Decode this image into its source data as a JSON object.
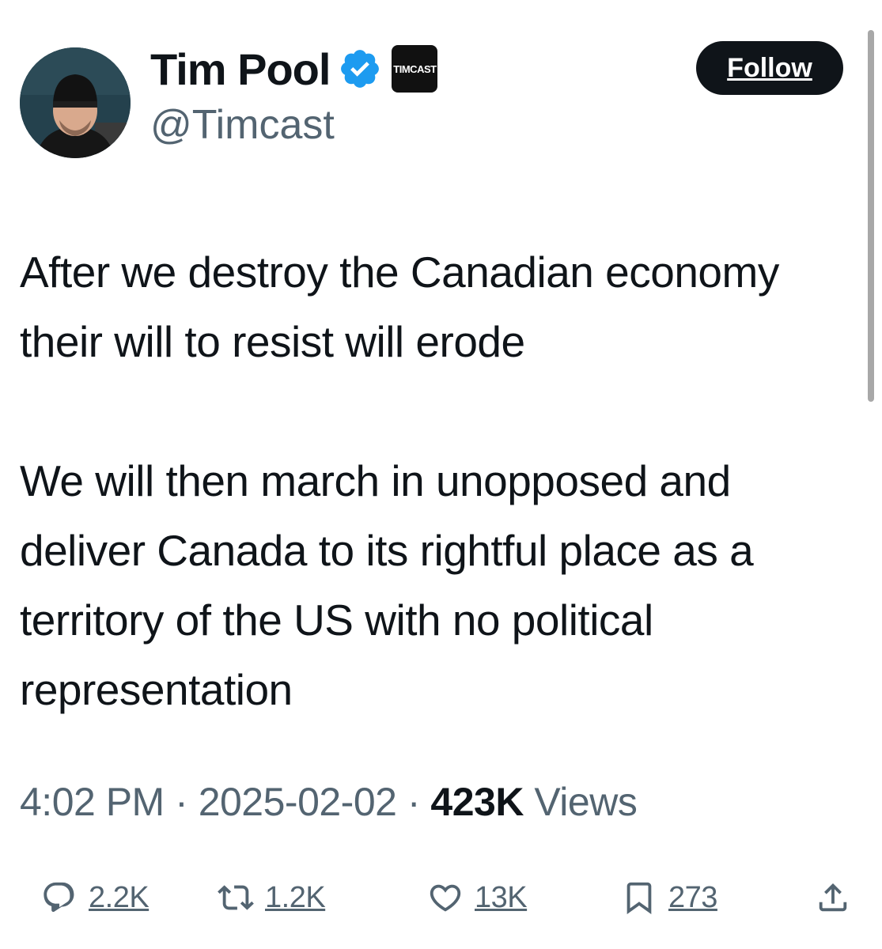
{
  "author": {
    "display_name": "Tim Pool",
    "handle": "@Timcast",
    "affiliate_badge": "TIMCAST",
    "verified": true
  },
  "follow_button": {
    "label": "Follow"
  },
  "tweet": {
    "paragraphs": [
      "After we destroy the Canadian economy their will to resist will erode",
      "We will then march in unopposed and deliver Canada to its rightful place as a territory of the US with no political representation"
    ]
  },
  "meta": {
    "time": "4:02 PM",
    "separator": "·",
    "date": "2025-02-02",
    "views_count": "423K",
    "views_label": "Views"
  },
  "actions": {
    "replies": "2.2K",
    "reposts": "1.2K",
    "likes": "13K",
    "bookmarks": "273"
  },
  "colors": {
    "text_primary": "#0f1419",
    "text_secondary": "#536471",
    "verified_blue": "#1d9bf0",
    "follow_bg": "#0f1419"
  }
}
